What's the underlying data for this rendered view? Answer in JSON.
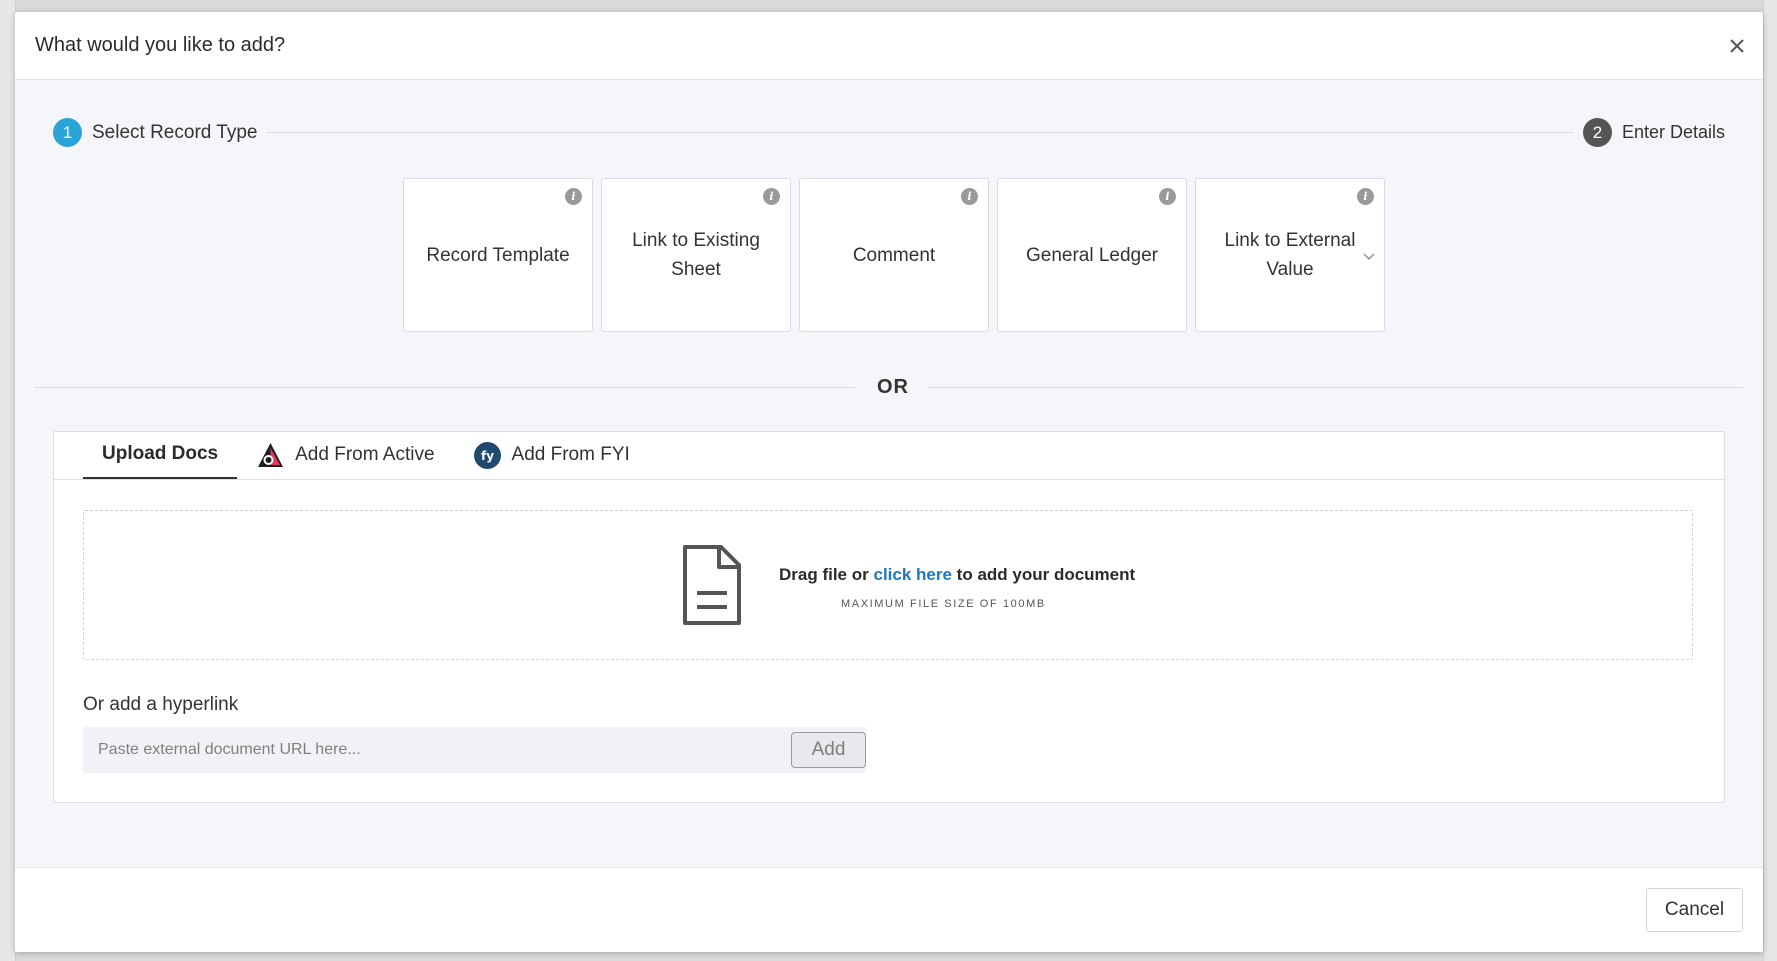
{
  "modal": {
    "title": "What would you like to add?",
    "close_icon": "close-icon"
  },
  "stepper": {
    "steps": [
      {
        "number": "1",
        "label": "Select Record Type",
        "active": true,
        "color": "#2aa3d9"
      },
      {
        "number": "2",
        "label": "Enter Details",
        "active": false,
        "color": "#555555"
      }
    ]
  },
  "record_types": [
    {
      "label": "Record Template",
      "icon": "info-icon"
    },
    {
      "label": "Link to Existing Sheet",
      "icon": "info-icon"
    },
    {
      "label": "Comment",
      "icon": "info-icon"
    },
    {
      "label": "General Ledger",
      "icon": "info-icon"
    },
    {
      "label": "Link to External Value",
      "icon": "info-icon",
      "has_dropdown": true
    }
  ],
  "divider": {
    "text": "OR"
  },
  "upload": {
    "tabs": [
      {
        "label": "Upload Docs",
        "active": true
      },
      {
        "label": "Add From Active",
        "icon": "active-logo-icon"
      },
      {
        "label": "Add From FYI",
        "icon": "fyi-logo-icon"
      }
    ],
    "dropzone": {
      "text_before": "Drag file or",
      "link_text": "click here",
      "text_after": "to add your document",
      "subtext": "MAXIMUM FILE SIZE OF 100MB",
      "icon": "document-icon"
    },
    "hyperlink": {
      "label": "Or add a hyperlink",
      "placeholder": "Paste external document URL here...",
      "value": "",
      "button_label": "Add"
    }
  },
  "footer": {
    "cancel_label": "Cancel"
  },
  "colors": {
    "accent": "#2aa3d9",
    "link": "#1a7bc4"
  }
}
